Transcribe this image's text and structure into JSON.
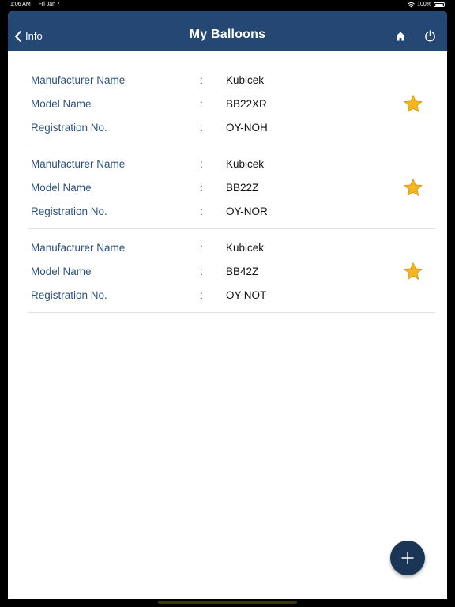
{
  "status_bar": {
    "time": "1:06 AM",
    "date": "Fri Jan 7",
    "battery": "100%",
    "battery_level": 1.0
  },
  "nav": {
    "back_label": "Info",
    "title": "My Balloons",
    "icons": [
      "chevron-left-icon",
      "home-icon",
      "power-icon"
    ]
  },
  "labels": {
    "manufacturer": "Manufacturer Name",
    "model": "Model Name",
    "registration": "Registration No.",
    "separator": ":"
  },
  "balloons": [
    {
      "manufacturer": "Kubicek",
      "model": "BB22XR",
      "registration": "OY-NOH",
      "favorite": true
    },
    {
      "manufacturer": "Kubicek",
      "model": "BB22Z",
      "registration": "OY-NOR",
      "favorite": true
    },
    {
      "manufacturer": "Kubicek",
      "model": "BB42Z",
      "registration": "OY-NOT",
      "favorite": true
    }
  ],
  "fab": {
    "icon": "plus-icon"
  },
  "colors": {
    "navbar": "#244774",
    "label": "#2e527f",
    "fab": "#1b3556",
    "star": "#f5b51f"
  }
}
